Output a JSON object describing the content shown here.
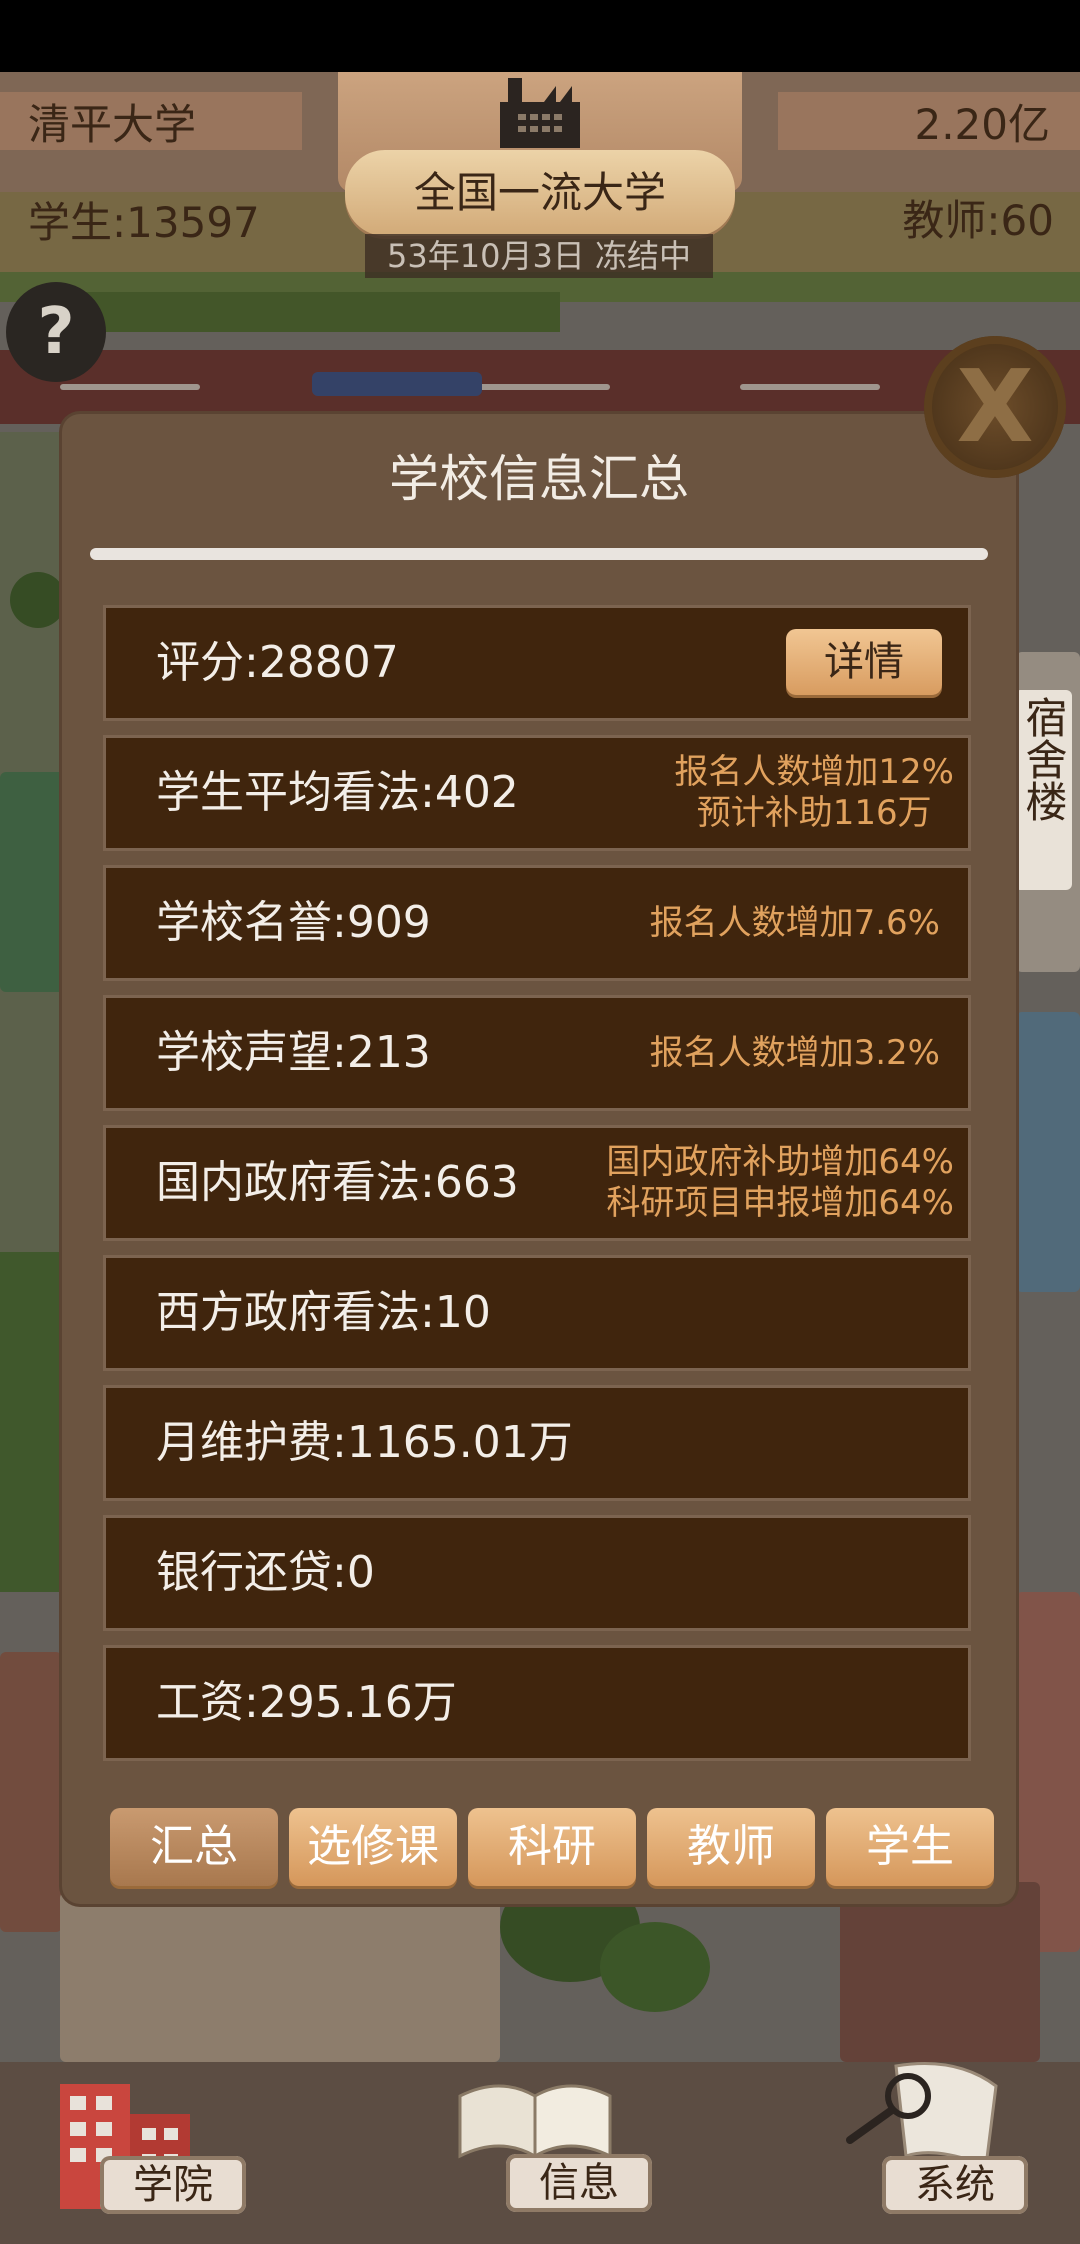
{
  "hud": {
    "university_name": "清平大学",
    "money": "2.20亿",
    "students": "学生:13597",
    "teachers": "教师:60",
    "rank_title": "全国一流大学",
    "date_status": "53年10月3日 冻结中"
  },
  "help_label": "?",
  "close_label": "X",
  "dialog": {
    "title": "学校信息汇总",
    "detail_button": "详情",
    "rows": [
      {
        "label": "评分:28807",
        "notes": []
      },
      {
        "label": "学生平均看法:402",
        "notes": [
          "报名人数增加12%",
          "预计补助116万"
        ]
      },
      {
        "label": "学校名誉:909",
        "notes": [
          "报名人数增加7.6%"
        ]
      },
      {
        "label": "学校声望:213",
        "notes": [
          "报名人数增加3.2%"
        ]
      },
      {
        "label": "国内政府看法:663",
        "notes": [
          "国内政府补助增加64%",
          "科研项目申报增加64%"
        ]
      },
      {
        "label": "西方政府看法:10",
        "notes": []
      },
      {
        "label": "月维护费:1165.01万",
        "notes": []
      },
      {
        "label": "银行还贷:0",
        "notes": []
      },
      {
        "label": "工资:295.16万",
        "notes": []
      }
    ],
    "tabs": [
      "汇总",
      "选修课",
      "科研",
      "教师",
      "学生"
    ]
  },
  "side_building_label": "宿舍楼",
  "bottom_nav": {
    "college": "学院",
    "info": "信息",
    "system": "系统"
  }
}
